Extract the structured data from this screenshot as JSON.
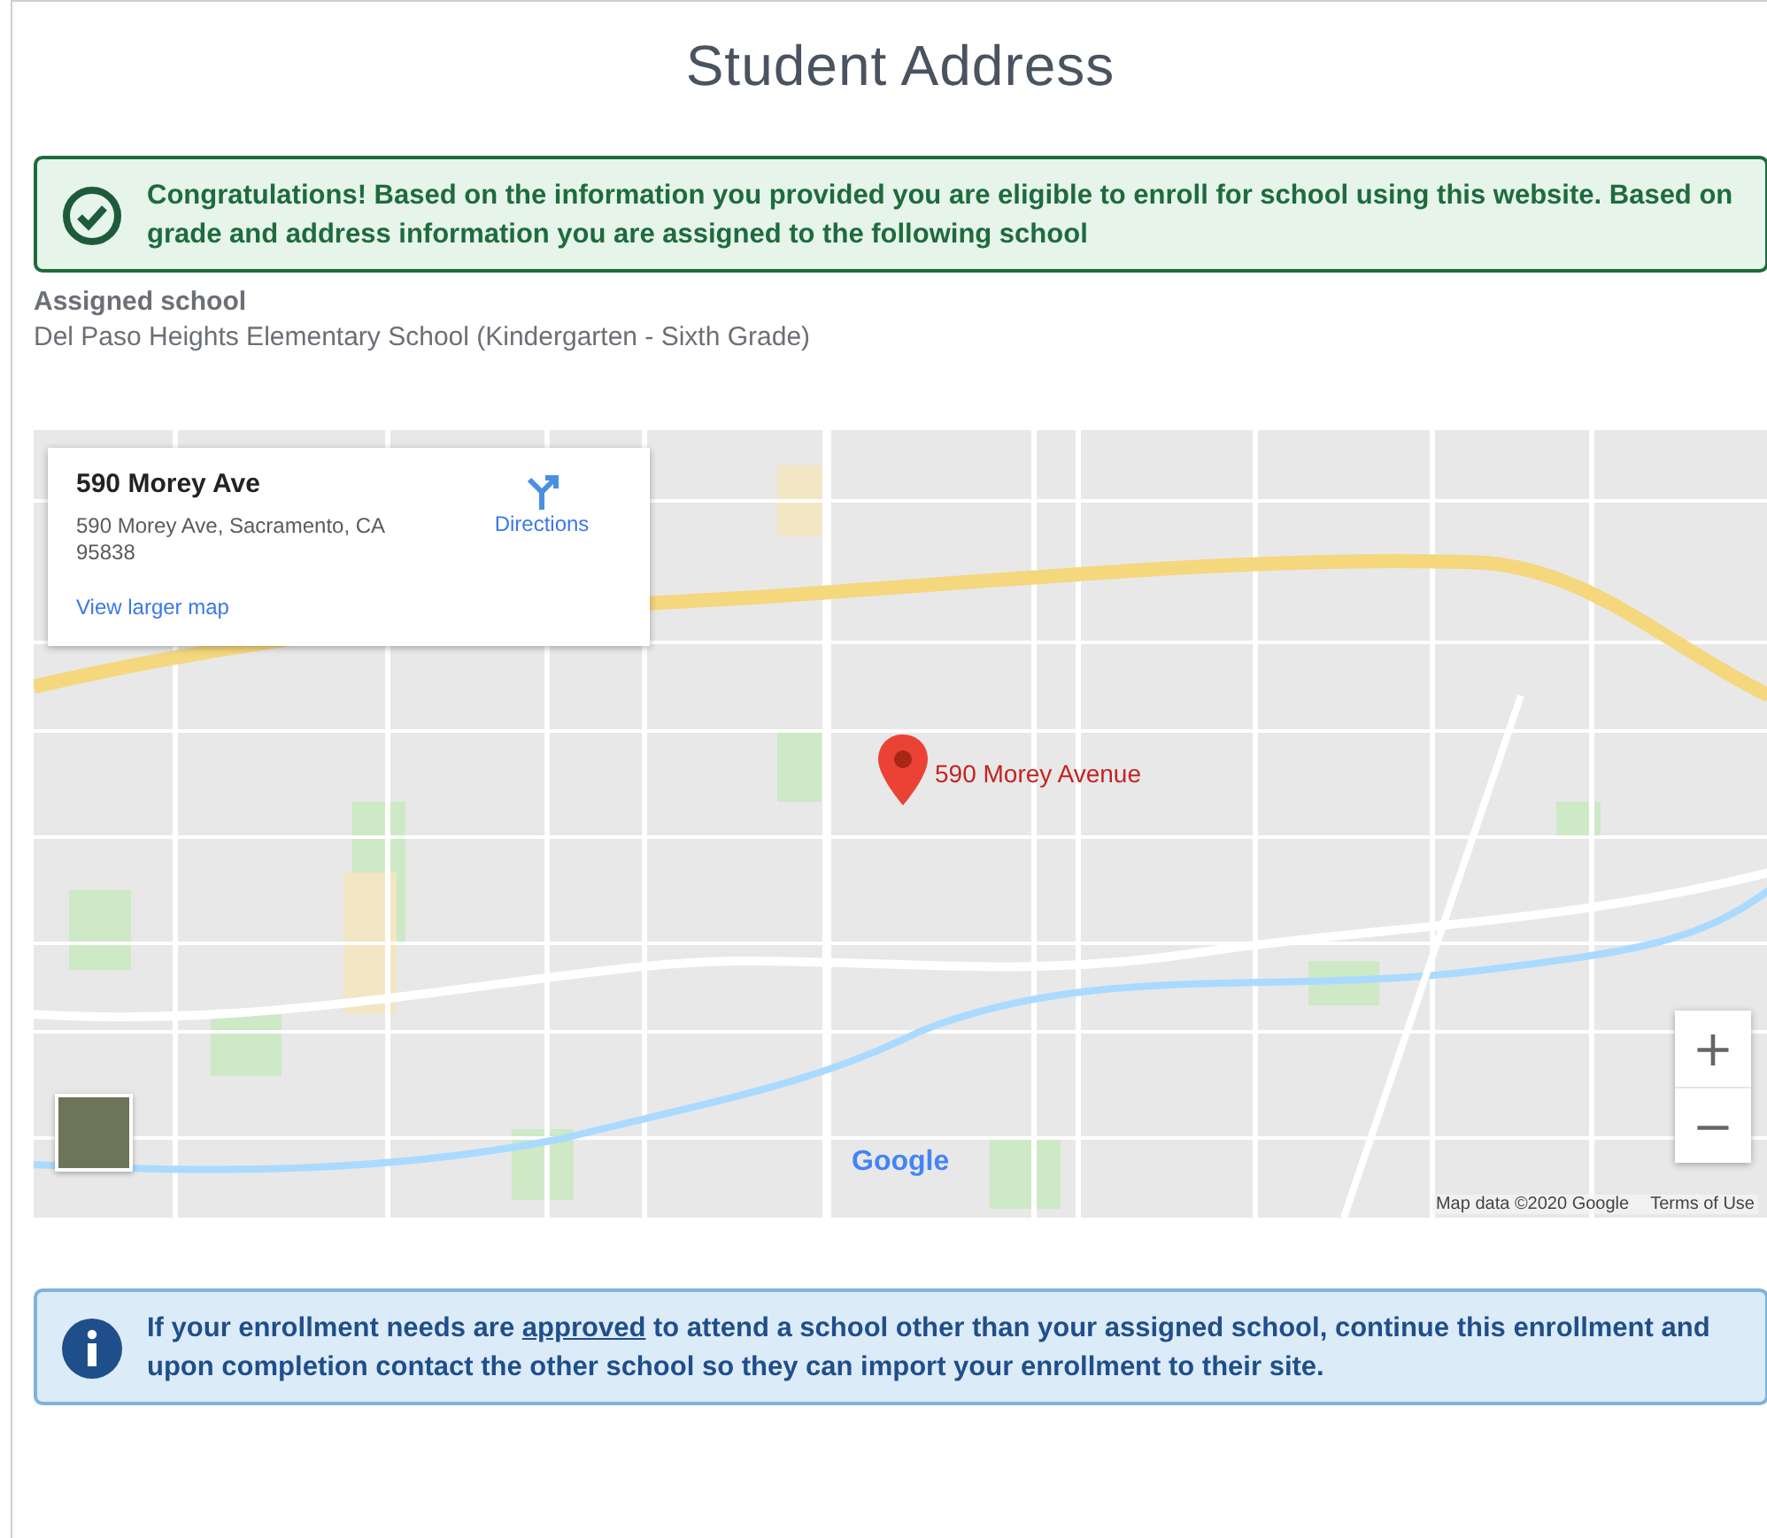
{
  "title": "Student Address",
  "success_alert": {
    "text": "Congratulations! Based on the information you provided you are eligible to enroll for school using this website. Based on grade and address information you are assigned to the following school"
  },
  "assigned_school": {
    "label": "Assigned school",
    "value": "Del Paso Heights Elementary School (Kindergarten - Sixth Grade)"
  },
  "map": {
    "info_card": {
      "title": "590 Morey Ave",
      "address": "590 Morey Ave, Sacramento, CA 95838",
      "directions": "Directions",
      "larger_map_link": "View larger map"
    },
    "marker_label": "590 Morey Avenue",
    "logo": "Google",
    "zoom_in": "+",
    "zoom_out": "−",
    "attribution": "Map data ©2020 Google",
    "terms": "Terms of Use"
  },
  "info_alert": {
    "before": "If your enrollment needs are ",
    "link": "approved",
    "after": " to attend a school other than your assigned school, continue this enrollment and upon completion contact the other school so they can import your enrollment to their site."
  }
}
